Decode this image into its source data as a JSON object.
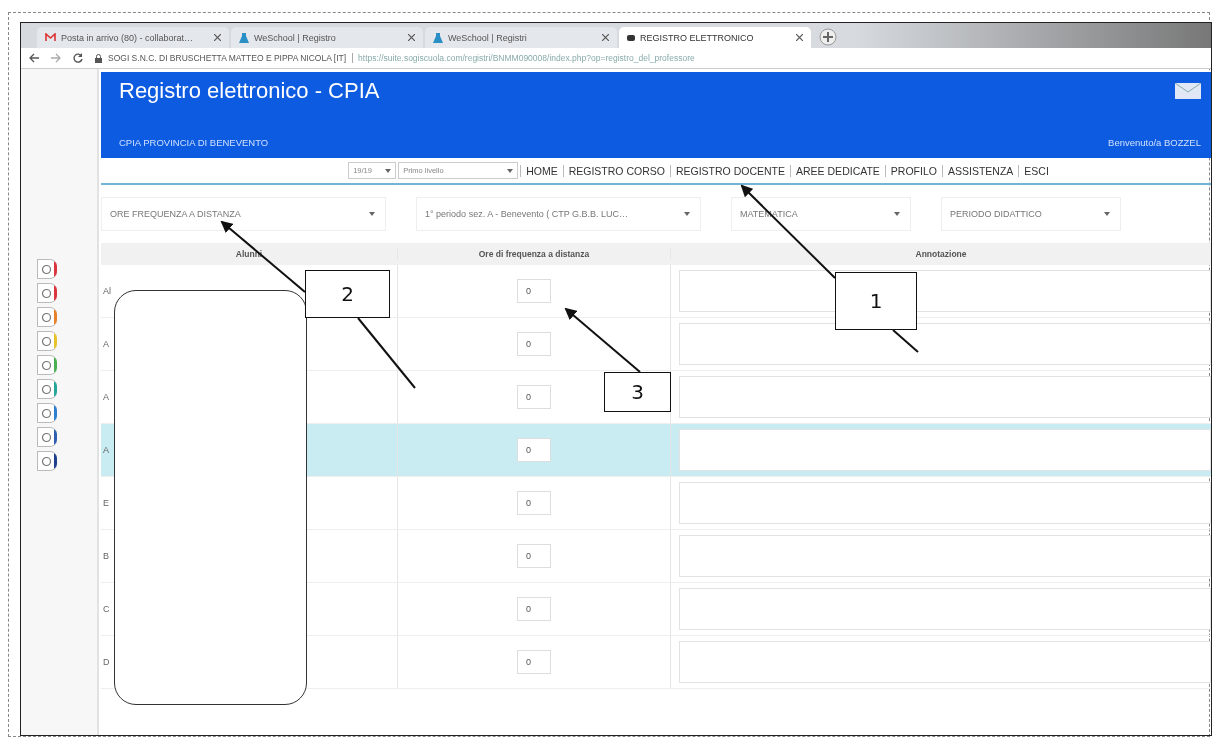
{
  "browser": {
    "tabs": [
      {
        "title": "Posta in arrivo (80) - collaborat…",
        "kind": "mail",
        "selected": false
      },
      {
        "title": "WeSchool | Registro",
        "kind": "flask",
        "selected": false
      },
      {
        "title": "WeSchool | Registri",
        "kind": "flask",
        "selected": false
      },
      {
        "title": "REGISTRO ELETTRONICO",
        "kind": "dot",
        "selected": true
      }
    ],
    "site": "SOGI S.N.C. DI BRUSCHETTA MATTEO E PIPPA NICOLA [IT]",
    "url": "https://suite.sogiscuola.com/registri/BNMM090008/index.php?op=registro_del_professore"
  },
  "header": {
    "title": "Registro elettronico - CPIA",
    "subtitle": "CPIA PROVINCIA DI BENEVENTO",
    "welcome": "Benvenuto/a BOZZEL"
  },
  "sidebar": {
    "icons": [
      {
        "color": "#d9363e"
      },
      {
        "color": "#d9363e"
      },
      {
        "color": "#e8822a"
      },
      {
        "color": "#e8c22a"
      },
      {
        "color": "#4caf50"
      },
      {
        "color": "#26a69a"
      },
      {
        "color": "#2f7fd1"
      },
      {
        "color": "#2f5fb1"
      },
      {
        "color": "#1f3f8f"
      }
    ]
  },
  "nav": {
    "year": "19/19",
    "level": "Primo livello",
    "items": [
      "HOME",
      "REGISTRO CORSO",
      "REGISTRO DOCENTE",
      "AREE DEDICATE",
      "PROFILO",
      "ASSISTENZA",
      "ESCI"
    ]
  },
  "filters": [
    "ORE FREQUENZA A DISTANZA",
    "1° periodo sez. A - Benevento ( CTP G.B.B. LUC…",
    "MATEMATICA",
    "PERIODO DIDATTICO"
  ],
  "table": {
    "columns": [
      "Alunni",
      "Ore di frequenza a distanza",
      "Annotazione"
    ],
    "rows": [
      {
        "name": "Al",
        "hours": "0",
        "selected": false
      },
      {
        "name": "A",
        "hours": "0",
        "selected": false
      },
      {
        "name": "A",
        "hours": "0",
        "selected": false
      },
      {
        "name": "A",
        "hours": "0",
        "selected": true
      },
      {
        "name": "E",
        "hours": "0",
        "selected": false
      },
      {
        "name": "B",
        "hours": "0",
        "selected": false
      },
      {
        "name": "C",
        "hours": "0",
        "selected": false
      },
      {
        "name": "D",
        "hours": "0",
        "selected": false
      }
    ]
  },
  "callouts": [
    {
      "label": "1"
    },
    {
      "label": "2"
    },
    {
      "label": "3"
    }
  ]
}
